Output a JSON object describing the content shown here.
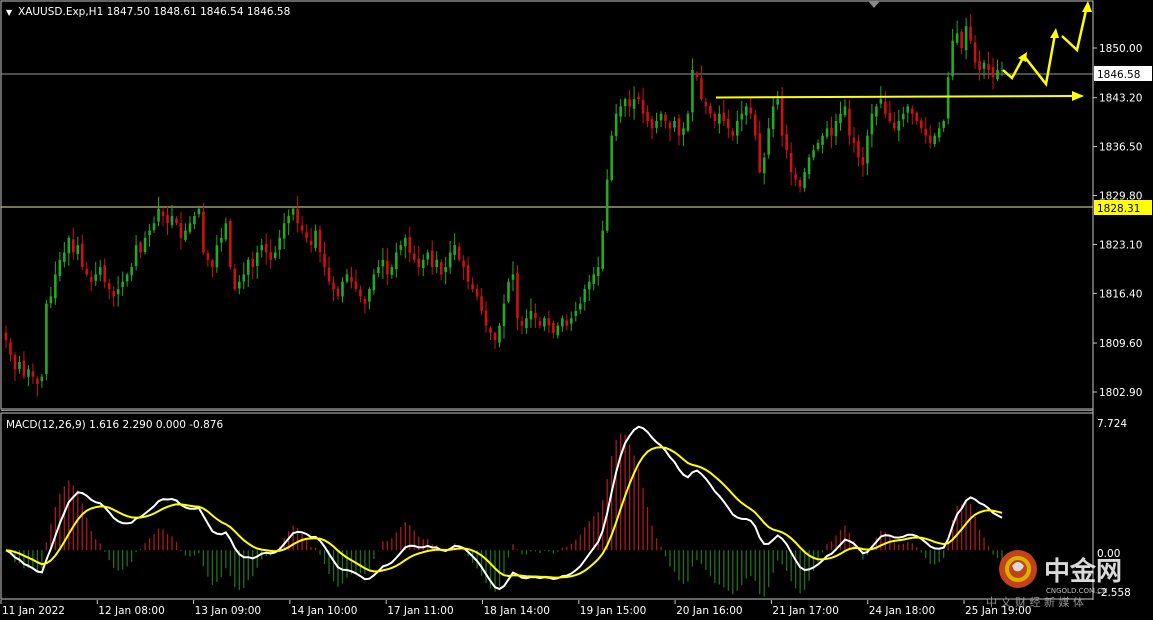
{
  "header": {
    "symbol_line": "XAUUSD.Exp,H1  1847.50 1848.61 1846.54 1846.58",
    "dropdown_glyph": "▼"
  },
  "price_axis": {
    "ticks": [
      "1850.00",
      "1843.20",
      "1836.50",
      "1829.80",
      "1823.10",
      "1816.40",
      "1809.60",
      "1802.90"
    ],
    "current_price_label": "1846.58",
    "level_label": "1828.31"
  },
  "macd": {
    "title_line": "MACD(12,26,9) 1.616 2.290 0.000 -0.876",
    "axis_top": "7.724",
    "axis_zero": "0.00",
    "axis_bottom": "-2.558"
  },
  "time_axis": [
    "11 Jan 2022",
    "12 Jan 08:00",
    "13 Jan 09:00",
    "14 Jan 10:00",
    "17 Jan 11:00",
    "18 Jan 14:00",
    "19 Jan 15:00",
    "20 Jan 16:00",
    "21 Jan 17:00",
    "24 Jan 18:00",
    "25 Jan 19:00"
  ],
  "watermark": {
    "brand": "中金网",
    "domain": "CNGOLD.COM.CN",
    "tagline": "中 文 财 经 新 媒 体"
  },
  "colors": {
    "bull": "#22aa22",
    "bear": "#cc1111",
    "macd_line": "#ffffff",
    "signal_line": "#ffff00",
    "annotation": "#ffff00"
  },
  "chart_data": {
    "type": "candlestick",
    "price_range": [
      1799.5,
      1856.0
    ],
    "horizontal_levels": [
      1846.58,
      1828.31
    ],
    "annotations": [
      {
        "kind": "arrow",
        "from_price": 1843.6,
        "to_price": 1843.6,
        "description": "horizontal resistance arrow"
      },
      {
        "kind": "zigzag_arrow",
        "description": "projected path upward"
      }
    ],
    "closes": [
      1810,
      1808,
      1806,
      1807,
      1805,
      1806,
      1805,
      1804,
      1805,
      1815,
      1816,
      1819,
      1821,
      1822,
      1824,
      1822,
      1823,
      1820,
      1819,
      1818,
      1819,
      1820,
      1818,
      1817,
      1816,
      1817,
      1818,
      1819,
      1820,
      1823,
      1822,
      1824,
      1825,
      1826,
      1828,
      1827,
      1826,
      1827,
      1826,
      1824,
      1825,
      1826,
      1827,
      1828,
      1822,
      1821,
      1820,
      1823,
      1824,
      1826,
      1820,
      1817,
      1818,
      1819,
      1821,
      1820,
      1822,
      1823,
      1822,
      1821,
      1822,
      1824,
      1826,
      1827,
      1828,
      1826,
      1825,
      1824,
      1823,
      1825,
      1822,
      1820,
      1818,
      1817,
      1816,
      1818,
      1819,
      1818,
      1817,
      1816,
      1815,
      1817,
      1819,
      1820,
      1821,
      1819,
      1820,
      1822,
      1823,
      1824,
      1822,
      1821,
      1820,
      1821,
      1822,
      1820,
      1821,
      1819,
      1820,
      1822,
      1823,
      1821,
      1820,
      1818,
      1817,
      1816,
      1814,
      1812,
      1811,
      1810,
      1812,
      1815,
      1818,
      1819,
      1813,
      1812,
      1813,
      1814,
      1813,
      1812,
      1813,
      1812,
      1811,
      1812,
      1813,
      1812,
      1813,
      1814,
      1815,
      1817,
      1818,
      1819,
      1820,
      1825,
      1832,
      1838,
      1841,
      1842,
      1843,
      1842,
      1843,
      1843,
      1841,
      1840,
      1839,
      1840,
      1841,
      1840,
      1839,
      1840,
      1838,
      1839,
      1841,
      1847,
      1846,
      1843,
      1842,
      1841,
      1840,
      1841,
      1840,
      1839,
      1838,
      1840,
      1841,
      1842,
      1841,
      1838,
      1833,
      1835,
      1839,
      1842,
      1843,
      1838,
      1836,
      1833,
      1832,
      1831,
      1833,
      1835,
      1836,
      1837,
      1838,
      1839,
      1838,
      1840,
      1841,
      1842,
      1838,
      1837,
      1835,
      1834,
      1838,
      1841,
      1842,
      1843,
      1841,
      1840,
      1839,
      1840,
      1841,
      1842,
      1841,
      1840,
      1839,
      1838,
      1837,
      1838,
      1839,
      1840,
      1846,
      1851,
      1852,
      1850,
      1853,
      1851,
      1848,
      1847,
      1848,
      1847,
      1846,
      1847,
      1847
    ]
  }
}
